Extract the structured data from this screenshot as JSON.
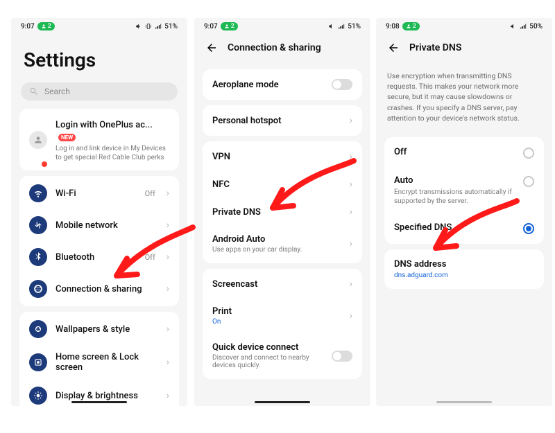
{
  "statusbar": {
    "s1": {
      "time": "9:07",
      "pill": "2",
      "battery": "51%"
    },
    "s2": {
      "time": "9:07",
      "pill": "2",
      "battery": "51%"
    },
    "s3": {
      "time": "9:08",
      "pill": "2",
      "battery": "50%"
    }
  },
  "screen1": {
    "title": "Settings",
    "search_placeholder": "Search",
    "account": {
      "title": "Login with OnePlus ac...",
      "badge": "NEW",
      "sub": "Log in and link device in My Devices to get special Red Cable Club perks"
    },
    "wifi": {
      "label": "Wi-Fi",
      "state": "Off"
    },
    "mobile": {
      "label": "Mobile network"
    },
    "bluetooth": {
      "label": "Bluetooth",
      "state": "Off"
    },
    "connshare": {
      "label": "Connection & sharing"
    },
    "wallpapers": {
      "label": "Wallpapers & style"
    },
    "home": {
      "label": "Home screen & Lock screen"
    },
    "display": {
      "label": "Display & brightness"
    }
  },
  "screen2": {
    "header": "Connection & sharing",
    "aeroplane": {
      "label": "Aeroplane mode"
    },
    "hotspot": {
      "label": "Personal hotspot"
    },
    "vpn": {
      "label": "VPN"
    },
    "nfc": {
      "label": "NFC"
    },
    "pdns": {
      "label": "Private DNS"
    },
    "aauto": {
      "label": "Android Auto",
      "sub": "Use apps on your car display."
    },
    "screencast": {
      "label": "Screencast"
    },
    "print": {
      "label": "Print",
      "state": "On"
    },
    "qdc": {
      "label": "Quick device connect",
      "sub": "Discover and connect to nearby devices quickly."
    }
  },
  "screen3": {
    "header": "Private DNS",
    "help": "Use encryption when transmitting DNS requests. This makes your network more secure, but it may cause slowdowns or crashes. If you specify a DNS server, pay attention to your device's network status.",
    "off": {
      "label": "Off"
    },
    "auto": {
      "label": "Auto",
      "sub": "Encrypt transmissions automatically if supported by the server."
    },
    "spec": {
      "label": "Specified DNS"
    },
    "dns": {
      "label": "DNS address",
      "value": "dns.adguard.com"
    }
  }
}
